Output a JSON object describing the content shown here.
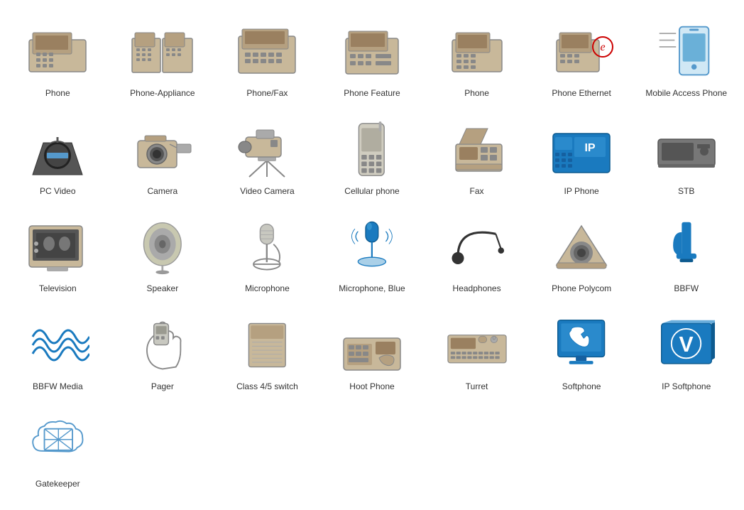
{
  "items": [
    {
      "id": "phone",
      "label": "Phone",
      "type": "phone"
    },
    {
      "id": "phone-appliance",
      "label": "Phone-Appliance",
      "type": "phone-appliance"
    },
    {
      "id": "phone-fax",
      "label": "Phone/Fax",
      "type": "phone-fax"
    },
    {
      "id": "phone-feature",
      "label": "Phone Feature",
      "type": "phone-feature"
    },
    {
      "id": "phone2",
      "label": "Phone",
      "type": "phone2"
    },
    {
      "id": "phone-ethernet",
      "label": "Phone Ethernet",
      "type": "phone-ethernet"
    },
    {
      "id": "mobile-access-phone",
      "label": "Mobile Access Phone",
      "type": "mobile-access-phone"
    },
    {
      "id": "pc-video",
      "label": "PC Video",
      "type": "pc-video"
    },
    {
      "id": "camera",
      "label": "Camera",
      "type": "camera"
    },
    {
      "id": "video-camera",
      "label": "Video Camera",
      "type": "video-camera"
    },
    {
      "id": "cellular-phone",
      "label": "Cellular phone",
      "type": "cellular-phone"
    },
    {
      "id": "fax",
      "label": "Fax",
      "type": "fax"
    },
    {
      "id": "ip-phone",
      "label": "IP Phone",
      "type": "ip-phone"
    },
    {
      "id": "stb",
      "label": "STB",
      "type": "stb"
    },
    {
      "id": "television",
      "label": "Television",
      "type": "television"
    },
    {
      "id": "speaker",
      "label": "Speaker",
      "type": "speaker"
    },
    {
      "id": "microphone",
      "label": "Microphone",
      "type": "microphone"
    },
    {
      "id": "microphone-blue",
      "label": "Microphone, Blue",
      "type": "microphone-blue"
    },
    {
      "id": "headphones",
      "label": "Headphones",
      "type": "headphones"
    },
    {
      "id": "phone-polycom",
      "label": "Phone Polycom",
      "type": "phone-polycom"
    },
    {
      "id": "bbfw",
      "label": "BBFW",
      "type": "bbfw"
    },
    {
      "id": "bbfw-media",
      "label": "BBFW Media",
      "type": "bbfw-media"
    },
    {
      "id": "pager",
      "label": "Pager",
      "type": "pager"
    },
    {
      "id": "class-switch",
      "label": "Class 4/5 switch",
      "type": "class-switch"
    },
    {
      "id": "hoot-phone",
      "label": "Hoot Phone",
      "type": "hoot-phone"
    },
    {
      "id": "turret",
      "label": "Turret",
      "type": "turret"
    },
    {
      "id": "softphone",
      "label": "Softphone",
      "type": "softphone"
    },
    {
      "id": "ip-softphone",
      "label": "IP Softphone",
      "type": "ip-softphone"
    },
    {
      "id": "gatekeeper",
      "label": "Gatekeeper",
      "type": "gatekeeper"
    }
  ]
}
